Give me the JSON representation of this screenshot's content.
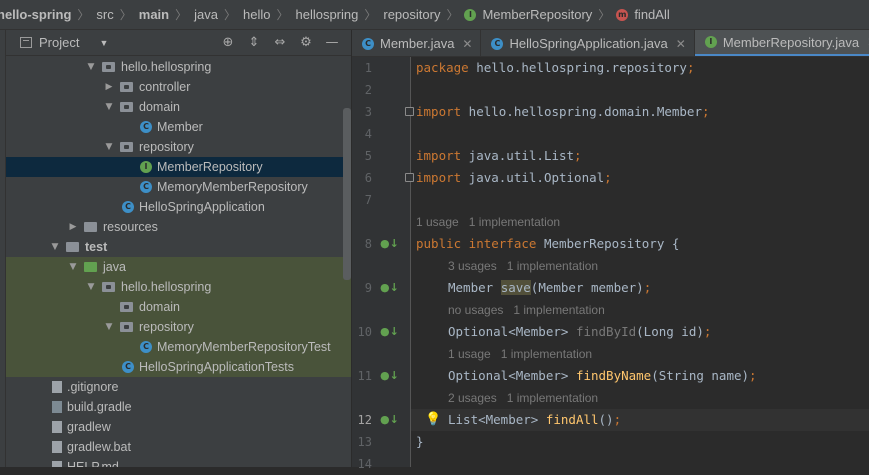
{
  "breadcrumb": {
    "items": [
      "hello-spring",
      "src",
      "main",
      "java",
      "hello",
      "hellospring",
      "repository",
      "MemberRepository",
      "findAll"
    ],
    "separator": "〉"
  },
  "project_panel": {
    "title": "Project",
    "tools": [
      "⊕",
      "⇕",
      "⇔",
      "⚙",
      "—"
    ],
    "tree": [
      {
        "label": "hello.hellospring",
        "expanded": true,
        "icon": "package-folder"
      },
      {
        "label": "controller",
        "expanded": false,
        "icon": "package-folder"
      },
      {
        "label": "domain",
        "expanded": true,
        "icon": "package-folder"
      },
      {
        "label": "Member",
        "icon": "class"
      },
      {
        "label": "repository",
        "expanded": true,
        "icon": "package-folder"
      },
      {
        "label": "MemberRepository",
        "icon": "interface",
        "selected": true
      },
      {
        "label": "MemoryMemberRepository",
        "icon": "class"
      },
      {
        "label": "HelloSpringApplication",
        "icon": "spring-class"
      },
      {
        "label": "resources",
        "expanded": false,
        "icon": "resources-folder"
      },
      {
        "label": "test",
        "expanded": true,
        "icon": "folder"
      },
      {
        "label": "java",
        "expanded": true,
        "icon": "test-folder"
      },
      {
        "label": "hello.hellospring",
        "expanded": true,
        "icon": "package-folder"
      },
      {
        "label": "domain",
        "icon": "package-folder"
      },
      {
        "label": "repository",
        "expanded": true,
        "icon": "package-folder"
      },
      {
        "label": "MemoryMemberRepositoryTest",
        "icon": "class"
      },
      {
        "label": "HelloSpringApplicationTests",
        "icon": "spring-class"
      },
      {
        "label": ".gitignore",
        "icon": "file"
      },
      {
        "label": "build.gradle",
        "icon": "gradle-file"
      },
      {
        "label": "gradlew",
        "icon": "file"
      },
      {
        "label": "gradlew.bat",
        "icon": "file"
      },
      {
        "label": "HELP.md",
        "icon": "file"
      }
    ]
  },
  "editor_tabs": [
    {
      "label": "Member.java",
      "icon": "C",
      "active": false
    },
    {
      "label": "HelloSpringApplication.java",
      "icon": "C",
      "active": false
    },
    {
      "label": "MemberRepository.java",
      "icon": "I",
      "active": true
    },
    {
      "label": "",
      "icon": "C",
      "active": false
    }
  ],
  "editor": {
    "line_numbers": [
      "1",
      "2",
      "3",
      "4",
      "5",
      "6",
      "7",
      "8",
      "9",
      "10",
      "11",
      "12",
      "13",
      "14"
    ],
    "current_line": "12",
    "code": {
      "l1_kw": "package",
      "l1_rest": " hello.hellospring.repository",
      "l1_semi": ";",
      "l3_kw": "import",
      "l3_rest": " hello.hellospring.domain.Member",
      "l3_semi": ";",
      "l5_kw": "import",
      "l5_rest": " java.util.List",
      "l5_semi": ";",
      "l6_kw": "import",
      "l6_rest": " java.util.Optional",
      "l6_semi": ";",
      "hint_interface": "1 usage   1 implementation",
      "l8_kw": "public interface",
      "l8_rest": " MemberRepository {",
      "hint_save": "3 usages   1 implementation",
      "l9_type": "Member ",
      "l9_method": "save",
      "l9_rest": "(Member member)",
      "l9_semi": ";",
      "hint_findById": "no usages   1 implementation",
      "l10_type": "Optional<Member> ",
      "l10_method": "findById",
      "l10_rest": "(Long id)",
      "l10_semi": ";",
      "hint_findByName": "1 usage   1 implementation",
      "l11_type": "Optional<Member> ",
      "l11_method": "findByName",
      "l11_rest": "(String name)",
      "l11_semi": ";",
      "hint_findAll": "2 usages   1 implementation",
      "l12_type": "List<Member> ",
      "l12_method": "findAll",
      "l12_rest": "()",
      "l12_semi": ";",
      "l13": "}"
    }
  },
  "colors": {
    "keyword": "#cc7832",
    "method": "#ffc66d",
    "text": "#a9b7c6",
    "hint": "#787878",
    "selection": "#0d293e",
    "test_highlight": "#49533a",
    "active_tab_underline": "#4a88c7"
  }
}
